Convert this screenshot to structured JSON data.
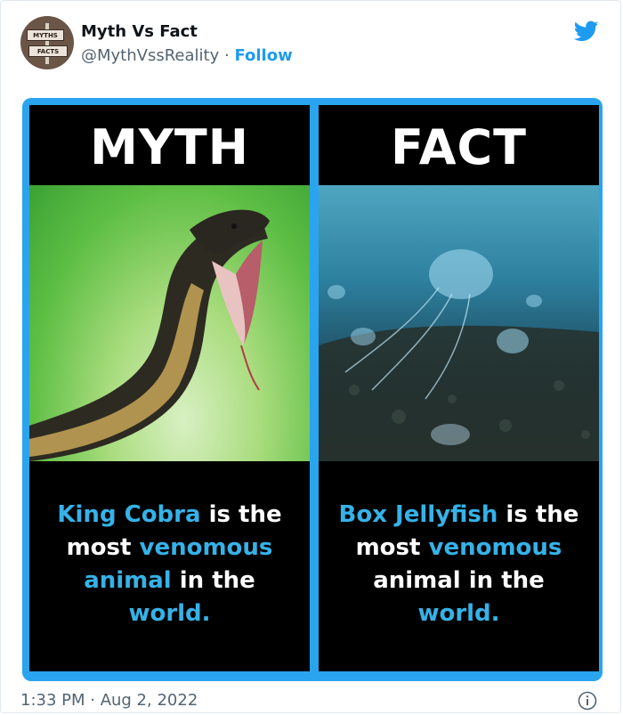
{
  "tweet": {
    "author": {
      "name": "Myth Vs Fact",
      "handle": "@MythVssReality",
      "separator": "·",
      "follow_label": "Follow",
      "avatar_signs": [
        "MYTHS",
        "FACTS"
      ]
    },
    "timestamp": "1:33 PM · Aug 2, 2022",
    "colors": {
      "twitter_blue": "#1d9bf0",
      "frame_blue": "#2aa4ee",
      "caption_highlight": "#35b2e8"
    }
  },
  "image": {
    "left": {
      "title": "MYTH",
      "caption": [
        {
          "text": "King Cobra",
          "highlight": true
        },
        {
          "text": " is the most ",
          "highlight": false
        },
        {
          "text": "venomous",
          "highlight": true
        },
        {
          "text": " ",
          "highlight": false
        },
        {
          "text": "animal",
          "highlight": true
        },
        {
          "text": " in the ",
          "highlight": false
        },
        {
          "text": "world.",
          "highlight": true
        }
      ]
    },
    "right": {
      "title": "FACT",
      "caption": [
        {
          "text": "Box Jellyfish",
          "highlight": true
        },
        {
          "text": " is the most ",
          "highlight": false
        },
        {
          "text": "venomous",
          "highlight": true
        },
        {
          "text": " animal in the ",
          "highlight": false
        },
        {
          "text": "world.",
          "highlight": true
        }
      ]
    }
  }
}
